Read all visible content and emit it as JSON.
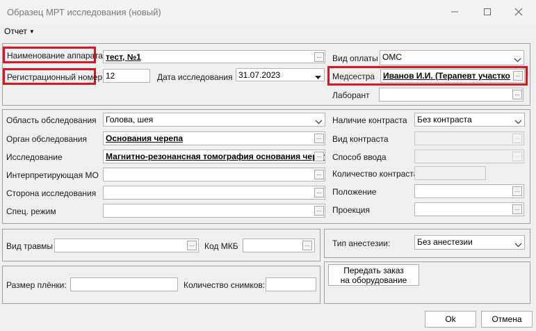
{
  "window": {
    "title": "Образец МРТ исследования (новый)"
  },
  "menu": {
    "report": "Отчет"
  },
  "section1": {
    "device_label": "Наименование аппарата",
    "device_value": "тест, №1",
    "regnum_label": "Регистрационный номер",
    "regnum_value": "12",
    "date_label": "Дата исследования",
    "date_value": "31.07.2023",
    "payment_label": "Вид оплаты",
    "payment_value": "ОМС",
    "nurse_label": "Медсестра",
    "nurse_value": "Иванов И.И. (Терапевт участко",
    "lab_label": "Лаборант",
    "lab_value": ""
  },
  "section2": {
    "area_label": "Область обследования",
    "area_value": "Голова, шея",
    "organ_label": "Орган обследования",
    "organ_value": "Основания черепа",
    "study_label": "Исследование",
    "study_value": "Магнитно-резонансная томография основания черепа",
    "interpreting_label": "Интерпретирующая МО",
    "interpreting_value": "",
    "side_label": "Сторона исследования",
    "side_value": "",
    "mode_label": "Спец. режим",
    "mode_value": "",
    "contrast_label": "Наличие контраста",
    "contrast_value": "Без контраста",
    "contrast_type_label": "Вид контраста",
    "contrast_type_value": "",
    "route_label": "Способ ввода",
    "route_value": "",
    "contrast_qty_label": "Количество контраста",
    "contrast_qty_value": "",
    "position_label": "Положение",
    "position_value": "",
    "projection_label": "Проекция",
    "projection_value": ""
  },
  "section3": {
    "trauma_label": "Вид травмы",
    "trauma_value": "",
    "mkb_label": "Код МКБ",
    "mkb_value": ""
  },
  "anesthesia": {
    "label": "Тип анестезии:",
    "value": "Без анестезии"
  },
  "section4": {
    "film_label": "Размер плёнки:",
    "film_value": "",
    "count_label": "Количество снимков:",
    "count_value": ""
  },
  "buttons": {
    "send_line1": "Передать заказ",
    "send_line2": "на оборудование",
    "ok": "Ok",
    "cancel": "Отмена"
  },
  "colors": {
    "highlight": "#e0141e"
  }
}
